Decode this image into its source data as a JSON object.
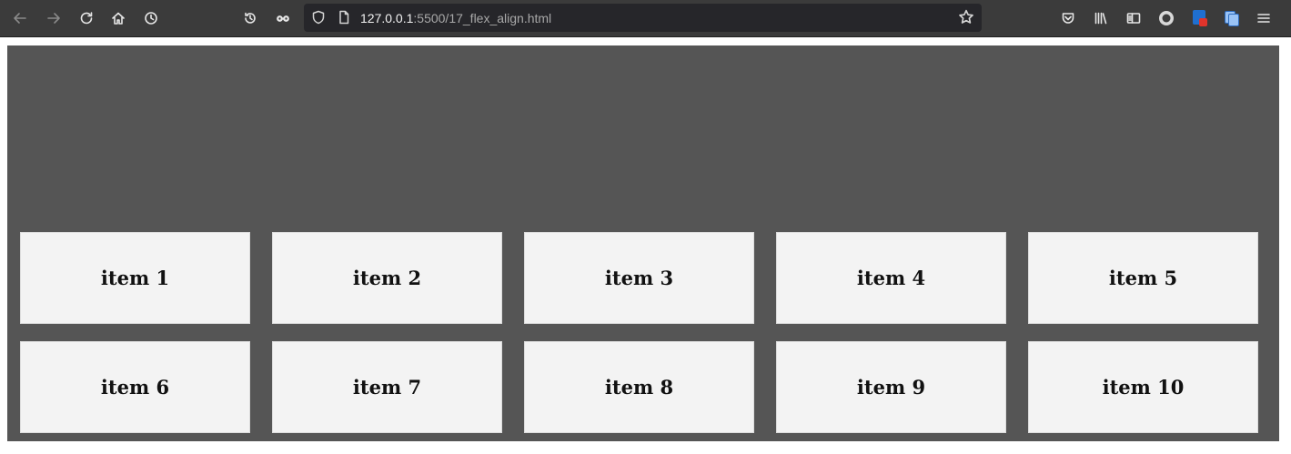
{
  "browser": {
    "url_host": "127.0.0.1",
    "url_rest": ":5500/17_flex_align.html",
    "icons": {
      "back": "arrow-left-icon",
      "forward": "arrow-right-icon",
      "reload": "reload-icon",
      "home": "home-icon",
      "history": "clock-icon",
      "restore": "history-icon",
      "private": "mask-icon",
      "shield": "shield-icon",
      "page": "page-icon",
      "bookmark": "star-icon",
      "pocket": "pocket-icon",
      "library": "library-icon",
      "sidebar": "sidebar-icon",
      "account": "account-icon",
      "menu": "hamburger-menu-icon"
    }
  },
  "page": {
    "background": "#555555",
    "item_background": "#f3f3f3",
    "items": [
      "item 1",
      "item 2",
      "item 3",
      "item 4",
      "item 5",
      "item 6",
      "item 7",
      "item 8",
      "item 9",
      "item 10"
    ]
  }
}
